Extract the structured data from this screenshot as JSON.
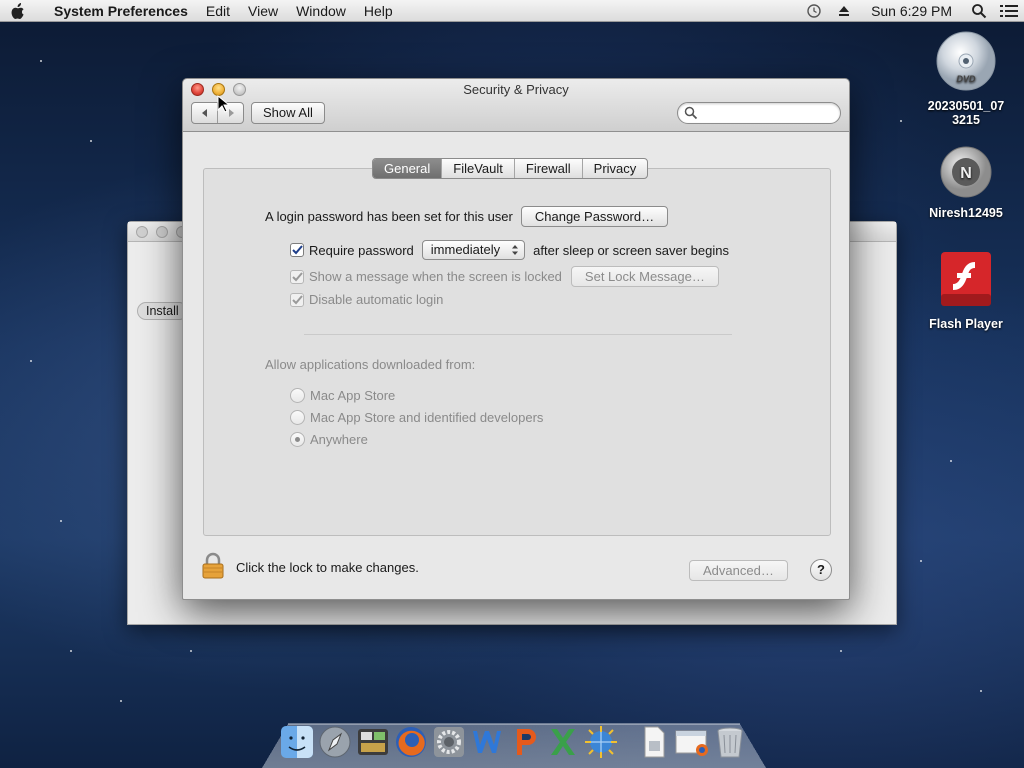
{
  "menubar": {
    "app_name": "System Preferences",
    "menus": [
      "Edit",
      "View",
      "Window",
      "Help"
    ],
    "clock": "Sun 6:29 PM",
    "right_icons": [
      "time-machine-icon",
      "eject-icon",
      "spotlight-icon",
      "notification-list-icon"
    ]
  },
  "desktop": {
    "icons": [
      {
        "label": "20230501_07\n3215",
        "icon": "dvd-icon"
      },
      {
        "label": "Niresh12495",
        "icon": "disk-icon"
      },
      {
        "label": "Flash Player",
        "icon": "flash-player-icon"
      }
    ]
  },
  "background_window": {
    "button_label": "Install"
  },
  "window": {
    "title": "Security & Privacy",
    "show_all": "Show All",
    "search_placeholder": "",
    "tabs": [
      {
        "label": "General",
        "active": true
      },
      {
        "label": "FileVault",
        "active": false
      },
      {
        "label": "Firewall",
        "active": false
      },
      {
        "label": "Privacy",
        "active": false
      }
    ],
    "general": {
      "login_text": "A login password has been set for this user",
      "change_password": "Change Password…",
      "require_password_label": "Require password",
      "require_password_checked": true,
      "require_password_value": "immediately",
      "after_sleep_text": "after sleep or screen saver begins",
      "show_message_label": "Show a message when the screen is locked",
      "show_message_checked": true,
      "set_lock_message": "Set Lock Message…",
      "disable_login_label": "Disable automatic login",
      "disable_login_checked": true,
      "allow_apps_heading": "Allow applications downloaded from:",
      "radio_options": [
        {
          "label": "Mac App Store",
          "selected": false
        },
        {
          "label": "Mac App Store and identified developers",
          "selected": false
        },
        {
          "label": "Anywhere",
          "selected": true
        }
      ]
    },
    "footer": {
      "lock_text": "Click the lock to make changes.",
      "advanced": "Advanced…",
      "help": "?"
    }
  },
  "dock": {
    "items": [
      "finder-icon",
      "launchpad-icon",
      "dashboard-icon",
      "firefox-icon",
      "system-preferences-icon",
      "word-icon",
      "powerpoint-icon",
      "excel-icon",
      "network-utility-icon",
      "documents-icon",
      "downloads-icon",
      "trash-icon"
    ]
  },
  "colors": {
    "accent": "#2a6bd6",
    "close": "#e0443a",
    "minimize": "#f0b23a",
    "flash_red": "#d6262a"
  }
}
